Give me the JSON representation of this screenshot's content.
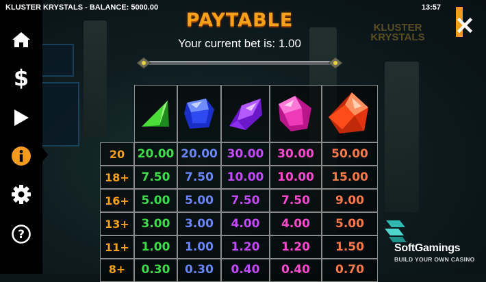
{
  "header": {
    "title": "KLUSTER KRYSTALS - BALANCE: 5000.00",
    "time": "13:57"
  },
  "sidebar": {
    "items": [
      {
        "icon": "home-icon",
        "active": false
      },
      {
        "icon": "dollar-icon",
        "active": false
      },
      {
        "icon": "play-icon",
        "active": false
      },
      {
        "icon": "info-icon",
        "active": true
      },
      {
        "icon": "gear-icon",
        "active": false
      },
      {
        "icon": "help-icon",
        "active": false
      }
    ],
    "accent": "#f39a1f"
  },
  "paytable": {
    "title": "PAYTABLE",
    "bet_text": "Your current bet is: 1.00",
    "symbols": [
      "green-gem-icon",
      "blue-gem-icon",
      "purple-gem-icon",
      "pink-gem-icon",
      "red-gem-icon"
    ],
    "rows": [
      {
        "count": "20",
        "values": [
          "20.00",
          "20.00",
          "30.00",
          "30.00",
          "50.00"
        ]
      },
      {
        "count": "18+",
        "values": [
          "7.50",
          "7.50",
          "10.00",
          "10.00",
          "15.00"
        ]
      },
      {
        "count": "16+",
        "values": [
          "5.00",
          "5.00",
          "7.50",
          "7.50",
          "9.00"
        ]
      },
      {
        "count": "13+",
        "values": [
          "3.00",
          "3.00",
          "4.00",
          "4.00",
          "5.00"
        ]
      },
      {
        "count": "11+",
        "values": [
          "1.00",
          "1.00",
          "1.20",
          "1.20",
          "1.50"
        ]
      },
      {
        "count": "8+",
        "values": [
          "0.30",
          "0.30",
          "0.40",
          "0.40",
          "0.70"
        ]
      }
    ]
  },
  "background": {
    "logo_text": "KLUSTER KRYSTALS"
  },
  "branding": {
    "name": "SoftGamings",
    "tagline": "BUILD YOUR OWN CASINO"
  }
}
